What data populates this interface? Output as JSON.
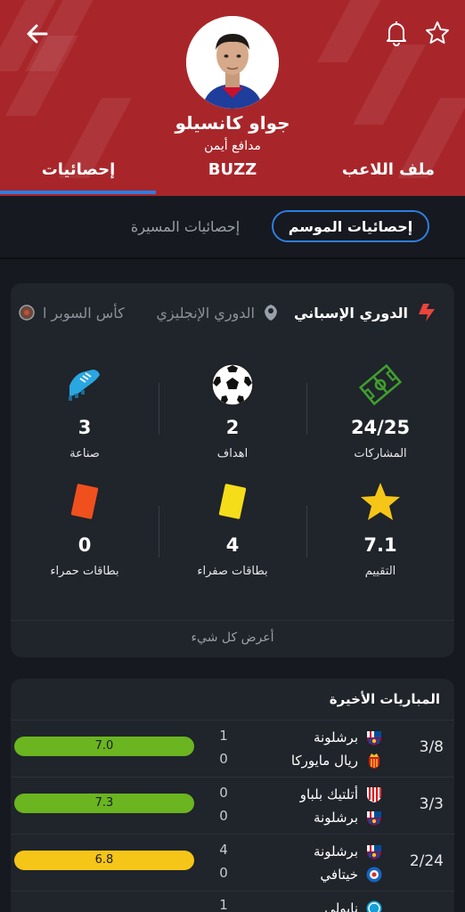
{
  "header": {
    "player_name": "جواو كانسيلو",
    "position": "مدافع أيمن",
    "tabs": [
      {
        "label": "ملف اللاعب"
      },
      {
        "label": "BUZZ"
      },
      {
        "label": "إحصائيات"
      }
    ],
    "active_tab": "إحصائيات"
  },
  "subtabs": {
    "active": "إحصائيات الموسم",
    "other": "إحصائيات المسيرة"
  },
  "leagues": [
    {
      "label": "الدوري الإسباني",
      "active": true
    },
    {
      "label": "الدوري الإنجليزي",
      "active": false
    },
    {
      "label": "كأس السوبر ا",
      "active": false
    }
  ],
  "stats": [
    {
      "value": "24/25",
      "label": "المشاركات",
      "icon": "pitch-icon"
    },
    {
      "value": "2",
      "label": "اهداف",
      "icon": "ball-icon"
    },
    {
      "value": "3",
      "label": "صناعة",
      "icon": "boot-icon"
    },
    {
      "value": "7.1",
      "label": "التقييم",
      "icon": "star-icon"
    },
    {
      "value": "4",
      "label": "بطاقات صفراء",
      "icon": "yellow-card-icon"
    },
    {
      "value": "0",
      "label": "بطاقات حمراء",
      "icon": "red-card-icon"
    }
  ],
  "show_all": "أعرض كل شيء",
  "recent": {
    "title": "المباريات الأخيرة",
    "matches": [
      {
        "date": "3/8",
        "home": "برشلونة",
        "away": "ريال مايوركا",
        "home_score": "1",
        "away_score": "0",
        "rating": "7.0",
        "rating_value": 7.0,
        "rating_color": "#6ab520"
      },
      {
        "date": "3/3",
        "home": "أتلتيك بلباو",
        "away": "برشلونة",
        "home_score": "0",
        "away_score": "0",
        "rating": "7.3",
        "rating_value": 7.3,
        "rating_color": "#6ab520"
      },
      {
        "date": "2/24",
        "home": "برشلونة",
        "away": "خيتافي",
        "home_score": "4",
        "away_score": "0",
        "rating": "6.8",
        "rating_value": 6.8,
        "rating_color": "#f5c518"
      },
      {
        "date": "",
        "home": "نابولي",
        "away": "",
        "home_score": "1",
        "away_score": "",
        "rating": "",
        "rating_value": null,
        "rating_color": ""
      }
    ]
  },
  "colors": {
    "header_bg": "#a8262a",
    "accent": "#2f7de1",
    "page_bg": "#16191f",
    "card_bg": "#20242b"
  }
}
